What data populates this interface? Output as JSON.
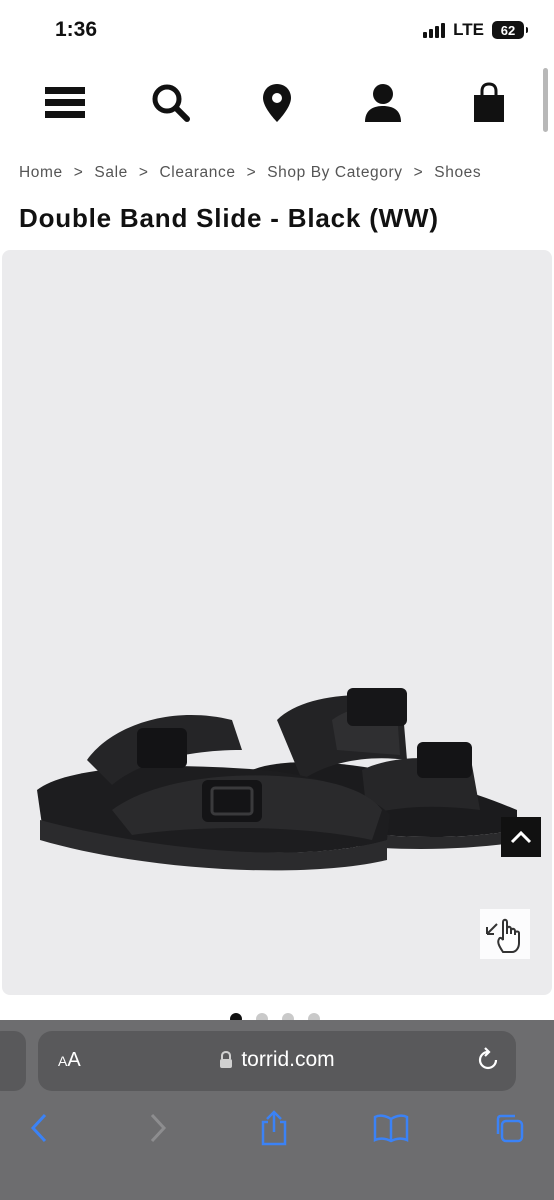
{
  "status_bar": {
    "time": "1:36",
    "network": "LTE",
    "battery": "62"
  },
  "header": {
    "icons": [
      "menu-icon",
      "search-icon",
      "location-pin-icon",
      "account-icon",
      "shopping-bag-icon"
    ]
  },
  "breadcrumb": {
    "items": [
      "Home",
      "Sale",
      "Clearance",
      "Shop By Category",
      "Shoes"
    ],
    "separator": ">"
  },
  "product": {
    "title": "Double Band Slide - Black (WW)",
    "image_background": "#ebebed",
    "carousel_total_dots": 4,
    "carousel_active_index": 0
  },
  "browser": {
    "text_size_label_small": "A",
    "text_size_label_large": "A",
    "url": "torrid.com",
    "toolbar_icons": [
      "back-icon",
      "forward-icon",
      "share-icon",
      "bookmarks-icon",
      "tabs-icon"
    ],
    "accent_color": "#3b82f6"
  }
}
